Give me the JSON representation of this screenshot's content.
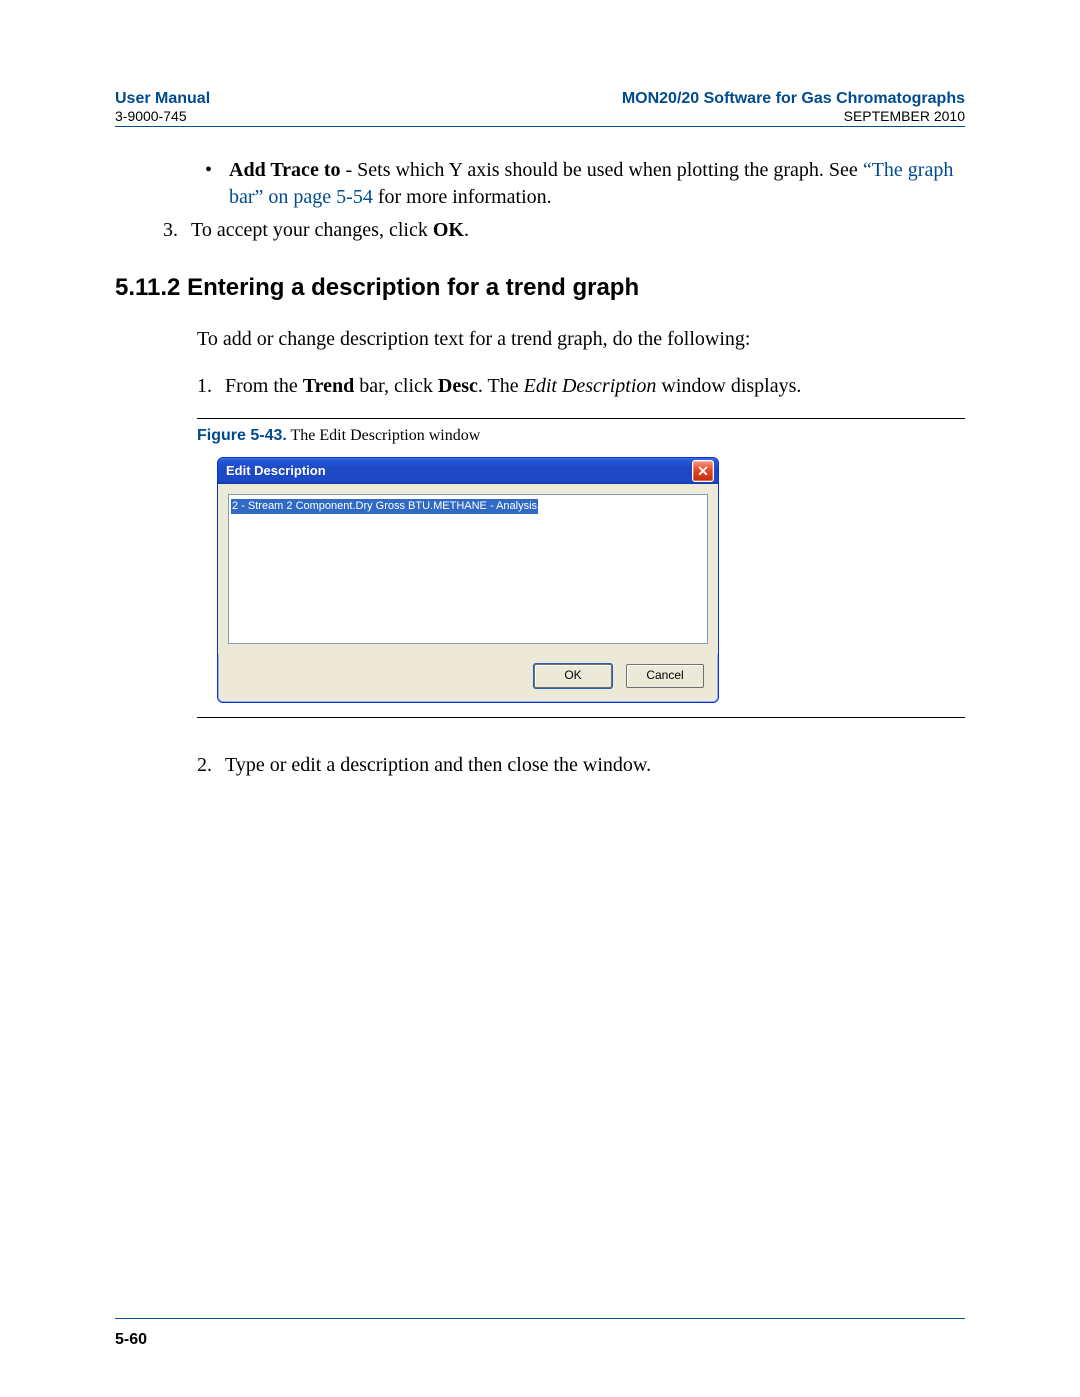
{
  "header": {
    "left_title": "User Manual",
    "left_sub": "3-9000-745",
    "right_title": "MON20/20 Software for Gas Chromatographs",
    "right_sub": "SEPTEMBER 2010"
  },
  "bullet": {
    "label": "Add Trace to",
    "text_after_label": " - Sets which Y axis should be used when plotting the graph.  See ",
    "link_text": "“The graph bar” on page 5-54",
    "text_after_link": " for more information."
  },
  "step3": {
    "num": "3.",
    "text_before": "To accept your changes, click ",
    "bold": "OK",
    "text_after": "."
  },
  "section": {
    "number": "5.11.2",
    "title": "Entering a description for a trend graph"
  },
  "intro": "To add or change description text for a trend graph, do the following:",
  "step1": {
    "num": "1.",
    "pre": "From the ",
    "b1": "Trend",
    "mid1": " bar, click ",
    "b2": "Desc",
    "mid2": ".  The ",
    "ital": "Edit Description",
    "post": " window displays."
  },
  "figure": {
    "label": "Figure 5-43.",
    "caption": "  The Edit Description window"
  },
  "dialog": {
    "title": "Edit Description",
    "close_glyph": "✕",
    "selected_text": "2 - Stream 2 Component.Dry Gross BTU.METHANE - Analysis",
    "ok_label": "OK",
    "cancel_label": "Cancel"
  },
  "step2": {
    "num": "2.",
    "text": "Type or edit a description and then close the window."
  },
  "page_number": "5-60"
}
